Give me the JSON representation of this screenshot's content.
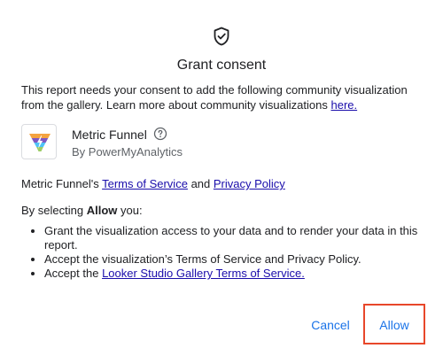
{
  "dialog": {
    "title": "Grant consent",
    "description": "This report needs your consent to add the following community visualization from the gallery. Learn more about community visualizations",
    "description_link": "here."
  },
  "visualization": {
    "name": "Metric Funnel",
    "author": "By PowerMyAnalytics",
    "logo_icon": "funnel-logo-icon",
    "help_icon": "help-circle-icon"
  },
  "links": {
    "prefix": "Metric Funnel's",
    "terms_label": "Terms of Service",
    "and": "and",
    "privacy_label": "Privacy Policy"
  },
  "selecting": {
    "prefix": "By selecting",
    "bold": "Allow",
    "suffix": "you:"
  },
  "points": [
    "Grant the visualization access to your data and to render your data in this report.",
    "Accept the visualization’s Terms of Service and Privacy Policy."
  ],
  "point3": {
    "prefix": "Accept the",
    "link": "Looker Studio Gallery Terms of Service."
  },
  "buttons": {
    "cancel": "Cancel",
    "allow": "Allow"
  },
  "colors": {
    "accent": "#1a73e8",
    "link": "#1a0dab",
    "highlight": "#e8472a"
  }
}
